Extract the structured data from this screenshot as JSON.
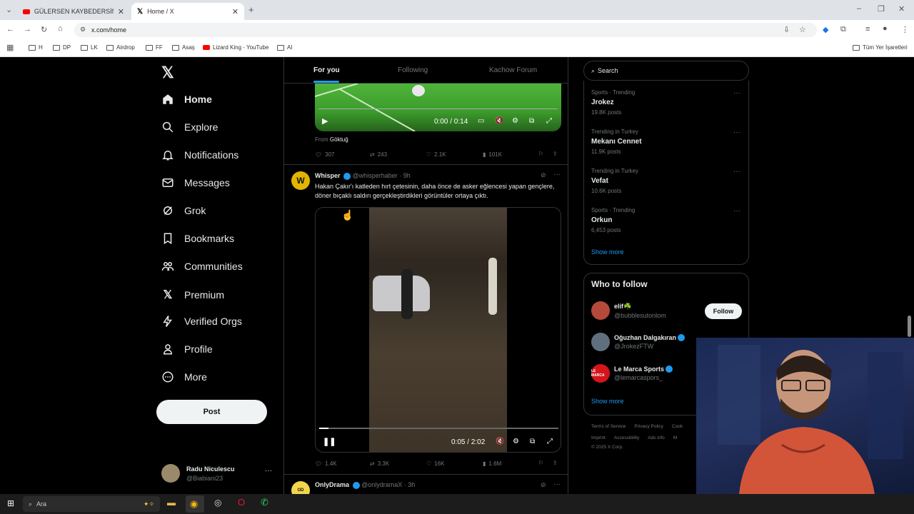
{
  "browser": {
    "tabs": [
      {
        "title": "GÜLERSEN KAYBEDERSİN w/ G"
      },
      {
        "title": "Home / X"
      }
    ],
    "url": "x.com/home",
    "bookmarks": [
      "H",
      "DP",
      "LK",
      "Airdrop",
      "FF",
      "Asaş",
      "Lizard King - YouTube",
      "AI"
    ],
    "all_bookmarks": "Tüm Yer İşaretleri"
  },
  "nav": {
    "items": [
      {
        "label": "Home",
        "icon": "home-icon"
      },
      {
        "label": "Explore",
        "icon": "search-icon"
      },
      {
        "label": "Notifications",
        "icon": "bell-icon"
      },
      {
        "label": "Messages",
        "icon": "mail-icon"
      },
      {
        "label": "Grok",
        "icon": "grok-icon"
      },
      {
        "label": "Bookmarks",
        "icon": "bookmark-icon"
      },
      {
        "label": "Communities",
        "icon": "people-icon"
      },
      {
        "label": "Premium",
        "icon": "x-logo-icon"
      },
      {
        "label": "Verified Orgs",
        "icon": "lightning-icon"
      },
      {
        "label": "Profile",
        "icon": "person-icon"
      },
      {
        "label": "More",
        "icon": "more-circle-icon"
      }
    ],
    "post_label": "Post",
    "account": {
      "name": "Radu Niculescu",
      "handle": "@Biabiani23"
    }
  },
  "timeline": {
    "tabs": [
      "For you",
      "Following",
      "Kachow Forum"
    ],
    "post1": {
      "video_time": "0:00 / 0:14",
      "from_label": "From",
      "from_name": "Göktuğ",
      "replies": "307",
      "reposts": "243",
      "likes": "2.1K",
      "views": "101K"
    },
    "post2": {
      "name": "Whisper",
      "handle": "@whisperhaber · 9h",
      "text": "Hakan Çakır'ı katleden hırt çetesinin, daha önce de asker eğlencesi yapan gençlere, döner bıçaklı saldırı gerçekleştirdikleri görüntüler ortaya çıktı.",
      "video_time": "0:05 / 2:02",
      "progress": 0.04,
      "replies": "1.4K",
      "reposts": "3.3K",
      "likes": "16K",
      "views": "1.6M"
    },
    "post3": {
      "name": "OnlyDrama",
      "handle": "@onlydramaX · 3h"
    }
  },
  "right": {
    "search_placeholder": "Search",
    "trends": [
      {
        "meta": "Sports · Trending",
        "name": "Jrokez",
        "posts": "19.8K posts"
      },
      {
        "meta": "Trending in Turkey",
        "name": "Mekanı Cennet",
        "posts": "11.9K posts"
      },
      {
        "meta": "Trending in Turkey",
        "name": "Vefat",
        "posts": "10.6K posts"
      },
      {
        "meta": "Sports · Trending",
        "name": "Orkun",
        "posts": "6,453 posts"
      }
    ],
    "show_more": "Show more",
    "who_to_follow_title": "Who to follow",
    "who_to_follow": [
      {
        "name": "elif☘️",
        "handle": "@bubblesutonlom"
      },
      {
        "name": "Oğuzhan Dalgakıran",
        "handle": "@JrokezFTW"
      },
      {
        "name": "Le Marca Sports",
        "handle": "@lemarcaspors_"
      }
    ],
    "follow_label": "Follow",
    "footer": {
      "line1": [
        "Terms of Service",
        "Privacy Policy",
        "Cook"
      ],
      "line2": [
        "Imprint",
        "Accessibility",
        "Ads info",
        "M"
      ],
      "copyright": "© 2025 X Corp."
    }
  },
  "taskbar": {
    "search_placeholder": "Ara"
  }
}
